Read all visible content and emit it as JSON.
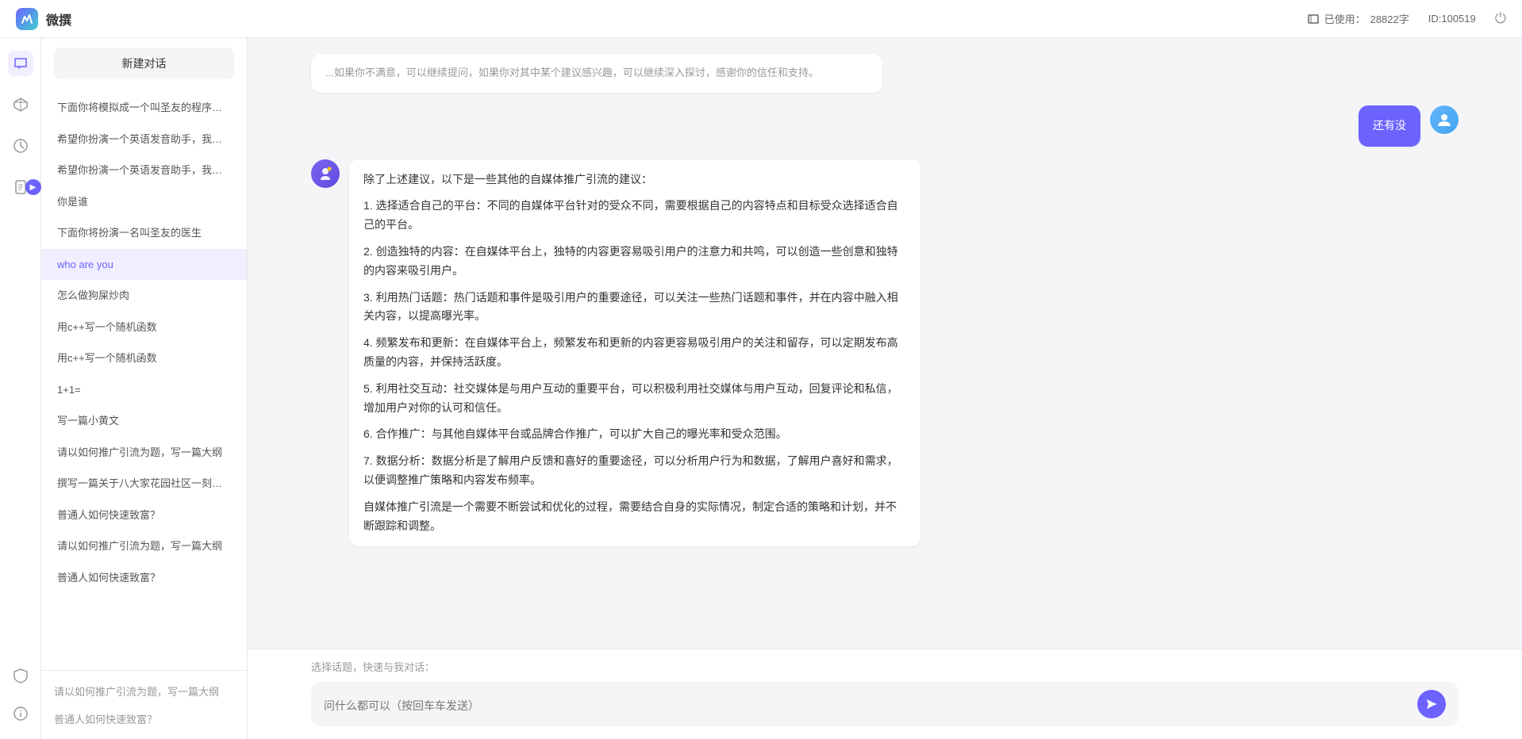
{
  "app": {
    "title": "微撰",
    "logo_text": "W",
    "usage_label": "已使用：",
    "usage_value": "28822字",
    "id_label": "ID:100519"
  },
  "sidebar_icons": [
    {
      "name": "chat-icon",
      "symbol": "💬",
      "active": true
    },
    {
      "name": "cube-icon",
      "symbol": "⬡",
      "active": false
    },
    {
      "name": "clock-icon",
      "symbol": "⏰",
      "active": false
    },
    {
      "name": "doc-icon",
      "symbol": "📄",
      "active": false
    }
  ],
  "sidebar_bottom_icons": [
    {
      "name": "shield-icon",
      "symbol": "🛡",
      "active": false
    },
    {
      "name": "info-icon",
      "symbol": "ⓘ",
      "active": false
    }
  ],
  "new_chat_label": "新建对话",
  "chat_history": [
    {
      "id": 1,
      "text": "下面你将模拟成一个叫圣友的程序员，我说..."
    },
    {
      "id": 2,
      "text": "希望你扮演一个英语发音助手，我提供给你..."
    },
    {
      "id": 3,
      "text": "希望你扮演一个英语发音助手，我提供给你..."
    },
    {
      "id": 4,
      "text": "你是谁"
    },
    {
      "id": 5,
      "text": "下面你将扮演一名叫圣友的医生"
    },
    {
      "id": 6,
      "text": "who are you",
      "active": true
    },
    {
      "id": 7,
      "text": "怎么做狗屎炒肉"
    },
    {
      "id": 8,
      "text": "用c++写一个随机函数"
    },
    {
      "id": 9,
      "text": "用c++写一个随机函数"
    },
    {
      "id": 10,
      "text": "1+1="
    },
    {
      "id": 11,
      "text": "写一篇小黄文"
    },
    {
      "id": 12,
      "text": "请以如何推广引流为题，写一篇大纲"
    },
    {
      "id": 13,
      "text": "撰写一篇关于八大家花园社区一刻钟便民生..."
    },
    {
      "id": 14,
      "text": "普通人如何快速致富？"
    },
    {
      "id": 15,
      "text": "请以如何推广引流为题，写一篇大纲"
    },
    {
      "id": 16,
      "text": "普通人如何快速致富？"
    }
  ],
  "partial_top_text": "...如果你不满意，可以继续提问，如果你对其中某个建议感兴趣，可以继续深入探讨，感谢你的信任和支持。",
  "messages": [
    {
      "role": "user",
      "text": "还有没",
      "avatar_type": "user"
    },
    {
      "role": "ai",
      "avatar_type": "ai",
      "content_paragraphs": [
        "除了上述建议，以下是一些其他的自媒体推广引流的建议：",
        "1. 选择适合自己的平台：不同的自媒体平台针对的受众不同，需要根据自己的内容特点和目标受众选择适合自己的平台。",
        "2. 创造独特的内容：在自媒体平台上，独特的内容更容易吸引用户的注意力和共鸣，可以创造一些创意和独特的内容来吸引用户。",
        "3. 利用热门话题：热门话题和事件是吸引用户的重要途径，可以关注一些热门话题和事件，并在内容中融入相关内容，以提高曝光率。",
        "4. 频繁发布和更新：在自媒体平台上，频繁发布和更新的内容更容易吸引用户的关注和留存，可以定期发布高质量的内容，并保持活跃度。",
        "5. 利用社交互动：社交媒体是与用户互动的重要平台，可以积极利用社交媒体与用户互动，回复评论和私信，增加用户对你的认可和信任。",
        "6. 合作推广：与其他自媒体平台或品牌合作推广，可以扩大自己的曝光率和受众范围。",
        "7. 数据分析：数据分析是了解用户反馈和喜好的重要途径，可以分析用户行为和数据，了解用户喜好和需求，以便调整推广策略和内容发布频率。",
        "自媒体推广引流是一个需要不断尝试和优化的过程，需要结合自身的实际情况，制定合适的策略和计划，并不断跟踪和调整。"
      ]
    }
  ],
  "quick_select_label": "选择话题，快速与我对话：",
  "input_placeholder": "问什么都可以（按回车车发送）",
  "send_button_label": "➤"
}
